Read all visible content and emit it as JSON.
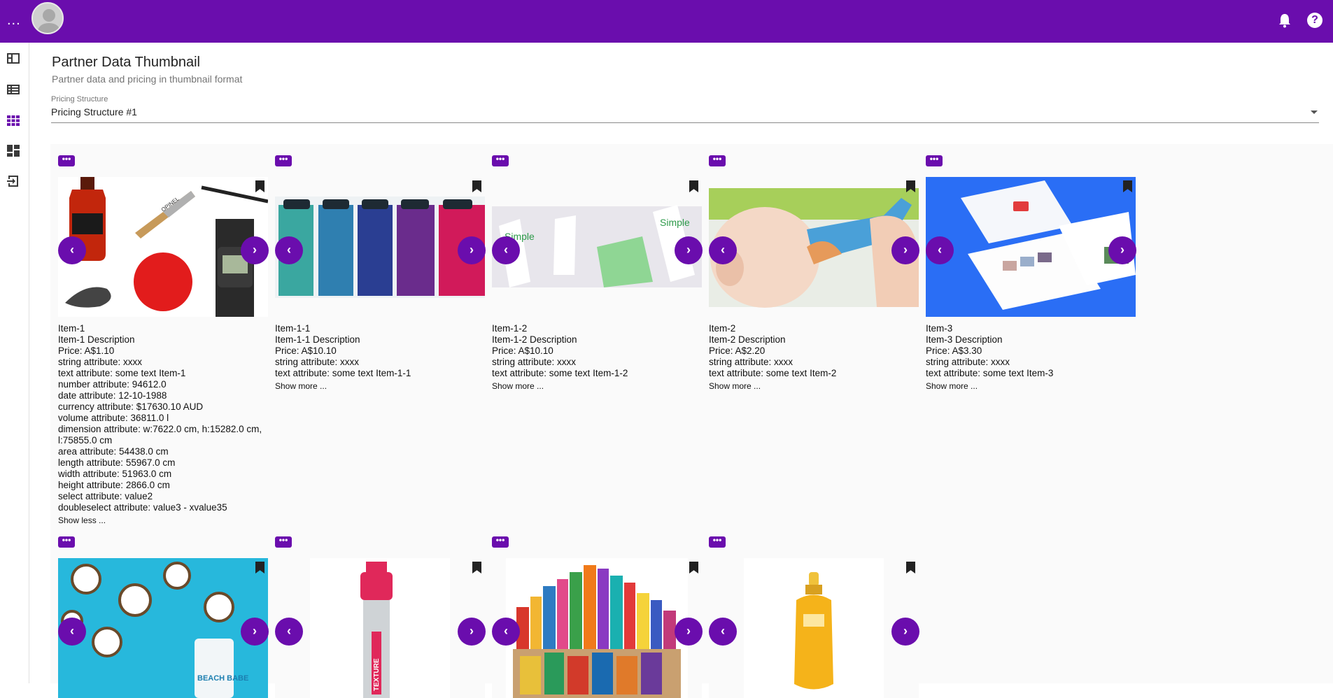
{
  "topbar": {
    "menu": "...",
    "help": "?"
  },
  "page": {
    "title": "Partner Data Thumbnail",
    "subtitle": "Partner data and pricing in thumbnail format"
  },
  "pricing": {
    "label": "Pricing Structure",
    "value": "Pricing Structure #1"
  },
  "cards": [
    {
      "name": "Item-1",
      "description": "Item-1 Description",
      "price": "Price: A$1.10",
      "lines": [
        "string attribute: xxxx",
        "text attribute: some text Item-1",
        "number attribute: 94612.0",
        "date attribute: 12-10-1988",
        "currency attribute: $17630.10 AUD",
        "volume attribute: 36811.0 l",
        "dimension attribute: w:7622.0 cm, h:15282.0 cm, l:75855.0 cm",
        "area attribute: 54438.0 cm",
        "length attribute: 55967.0 cm",
        "width attribute: 51963.0 cm",
        "height attribute: 2866.0 cm",
        "select attribute: value2",
        "doubleselect attribute: value3 - xvalue35"
      ],
      "toggle": "Show less ..."
    },
    {
      "name": "Item-1-1",
      "description": "Item-1-1 Description",
      "price": "Price: A$10.10",
      "lines": [
        "string attribute: xxxx",
        "text attribute: some text Item-1-1"
      ],
      "toggle": "Show more ..."
    },
    {
      "name": "Item-1-2",
      "description": "Item-1-2 Description",
      "price": "Price: A$10.10",
      "lines": [
        "string attribute: xxxx",
        "text attribute: some text Item-1-2"
      ],
      "toggle": "Show more ..."
    },
    {
      "name": "Item-2",
      "description": "Item-2 Description",
      "price": "Price: A$2.20",
      "lines": [
        "string attribute: xxxx",
        "text attribute: some text Item-2"
      ],
      "toggle": "Show more ..."
    },
    {
      "name": "Item-3",
      "description": "Item-3 Description",
      "price": "Price: A$3.30",
      "lines": [
        "string attribute: xxxx",
        "text attribute: some text Item-3"
      ],
      "toggle": "Show more ..."
    }
  ],
  "tag_text": "•••",
  "prev_glyph": "‹",
  "next_glyph": "›",
  "image_texts": {
    "opinel": "OPINEL",
    "simple_1": "Simple",
    "simple_2": "Simple",
    "beach_babe": "BEACH BABE",
    "texture": "TEXTURE"
  },
  "colors": {
    "brand": "#6a0dad",
    "sidebar_active": "#6a0dad"
  }
}
